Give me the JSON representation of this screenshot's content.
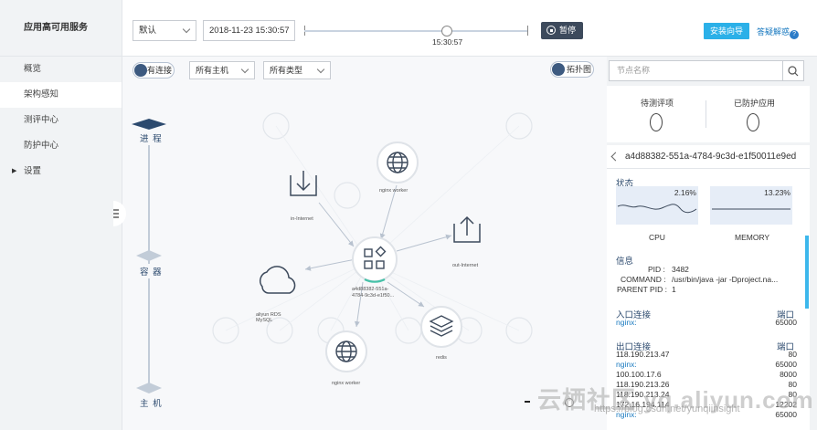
{
  "sidebar": {
    "title": "应用高可用服务",
    "items": [
      {
        "label": "概览"
      },
      {
        "label": "架构感知"
      },
      {
        "label": "测评中心"
      },
      {
        "label": "防护中心"
      },
      {
        "label": "设置"
      }
    ]
  },
  "topbar": {
    "env_select": "默认",
    "datetime": "2018-11-23 15:30:57",
    "slider_time": "15:30:57",
    "slider_position": 0.62,
    "pause_label": "暂停",
    "guide_button": "安装向导",
    "faq_link": "答疑解惑"
  },
  "canvas": {
    "connection_toggle": "有连接",
    "host_filter": "所有主机",
    "type_filter": "所有类型",
    "topology_toggle": "拓扑图",
    "layers": [
      "进 程",
      "容 器",
      "主 机"
    ],
    "nodes": {
      "nginx_top": "nginx worker",
      "in_internet": "in-Internet",
      "out_internet": "out-Internet",
      "center": "a4d88382-551a-4784-9c3d-e1f50...",
      "aliyun_mysql": "aliyun RDS MySQL",
      "nginx_bottom": "nginx worker",
      "redis": "redis"
    }
  },
  "panel": {
    "search_placeholder": "节点名称",
    "pending_label": "待测评项",
    "pending_value": "0",
    "protected_label": "已防护应用",
    "protected_value": "0",
    "detail_title": "a4d88382-551a-4784-9c3d-e1f50011e9ed",
    "status_label": "状态",
    "cpu_pct": "2.16%",
    "cpu_label": "CPU",
    "mem_pct": "13.23%",
    "mem_label": "MEMORY",
    "info_label": "信息",
    "pid_label": "PID :",
    "pid_value": "3482",
    "command_label": "COMMAND :",
    "command_value": "/usr/bin/java -jar -Dproject.na...",
    "ppid_label": "PARENT PID :",
    "ppid_value": "1",
    "inbound_label": "入口连接",
    "port_label": "端口",
    "inbound": [
      {
        "name": "nginx:",
        "port": "65000"
      }
    ],
    "outbound_label": "出口连接",
    "outbound": [
      {
        "name": "118.190.213.47",
        "port": "80"
      },
      {
        "name": "nginx:",
        "port": "65000"
      },
      {
        "name": "100.100.17.6",
        "port": "8000"
      },
      {
        "name": "118.190.213.26",
        "port": "80"
      },
      {
        "name": "118.190.213.24",
        "port": "80"
      },
      {
        "name": "172.16.194.114",
        "port": "12202"
      },
      {
        "name": "nginx:",
        "port": "65000"
      }
    ]
  },
  "watermark": "云栖社区 yq.aliyun.com",
  "watermark_url": "https://blog.csdn.net/yunqiinsight"
}
